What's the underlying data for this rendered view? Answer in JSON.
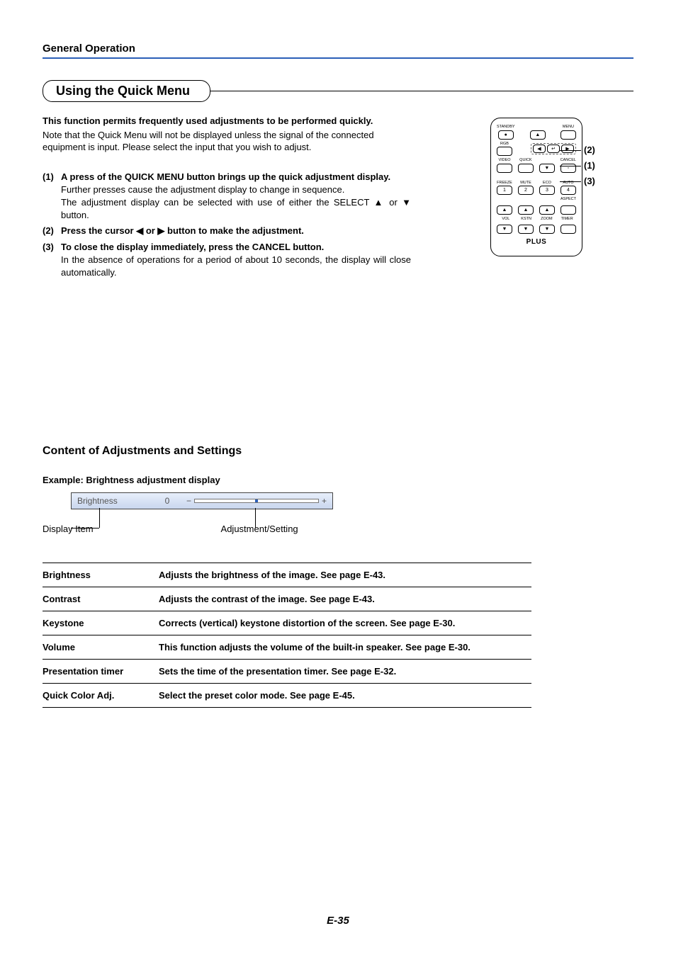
{
  "header": {
    "section": "General Operation"
  },
  "page_title": "Using the Quick Menu",
  "intro": {
    "bold": "This function permits frequently used adjustments to be performed quickly.",
    "text": "Note that the Quick Menu will not be displayed unless the signal of the connected equipment is input. Please select the input that you wish to adjust."
  },
  "steps": [
    {
      "num": "(1)",
      "title": "A press of the QUICK MENU button brings up the quick adjustment display.",
      "text1": "Further presses cause the adjustment display to change in sequence.",
      "text2": "The adjustment display can be selected with use of either the SELECT ▲ or ▼ button."
    },
    {
      "num": "(2)",
      "title": "Press the cursor ◀ or ▶ button to make the adjustment."
    },
    {
      "num": "(3)",
      "title": "To close the display immediately, press the CANCEL button.",
      "text1": "In the absence of operations for a period of about 10 seconds, the display will close automatically."
    }
  ],
  "remote": {
    "labels": {
      "standby": "STANDBY",
      "menu": "MENU",
      "rgb": "RGB",
      "enter": "ENTER",
      "video": "VIDEO",
      "quick": "QUICK",
      "cancel": "CANCEL",
      "freeze": "FREEZE",
      "mute": "MUTE",
      "eco": "ECO",
      "auto": "AUTO",
      "aspect": "ASPECT",
      "vol": "VOL",
      "kstn": "KSTN",
      "zoom": "ZOOM",
      "timer": "TIMER"
    },
    "nums": {
      "n1": "1",
      "n2": "2",
      "n3": "3",
      "n4": "4"
    },
    "brand": "PLUS"
  },
  "callouts": {
    "c1": "(1)",
    "c2": "(2)",
    "c3": "(3)"
  },
  "subsection": "Content of Adjustments and Settings",
  "example_label": "Example: Brightness adjustment display",
  "osd": {
    "name": "Brightness",
    "value": "0",
    "minus": "−",
    "plus": "+"
  },
  "labels_under": {
    "left": "Display Item",
    "right": "Adjustment/Setting"
  },
  "table": [
    {
      "name": "Brightness",
      "desc": "Adjusts the brightness of the image. See page E-43."
    },
    {
      "name": "Contrast",
      "desc": "Adjusts the contrast of the image. See page E-43."
    },
    {
      "name": "Keystone",
      "desc": "Corrects (vertical) keystone distortion of the screen.  See page E-30."
    },
    {
      "name": "Volume",
      "desc": "This function adjusts the volume of the built-in speaker. See page E-30."
    },
    {
      "name": "Presentation timer",
      "desc": "Sets the time of the presentation timer.  See page E-32."
    },
    {
      "name": "Quick Color Adj.",
      "desc": "Select the preset color mode. See page E-45."
    }
  ],
  "page_number": "E-35"
}
